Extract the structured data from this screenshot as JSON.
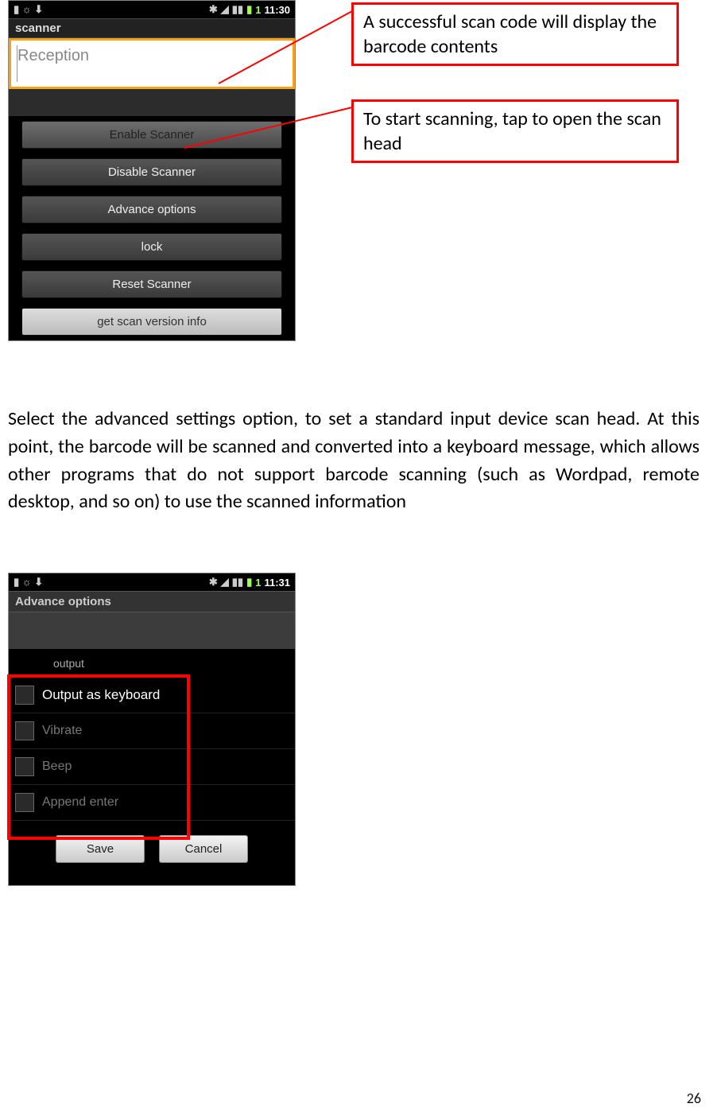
{
  "callouts": {
    "scan_result": "A successful scan code will display the barcode contents",
    "start_scan": "To start scanning, tap to open the scan head"
  },
  "phone1": {
    "status": {
      "left_icons": "▮ ☼ ⬇",
      "bt": "✱",
      "wifi": "◢",
      "sig": "▮▮",
      "bat": "▮",
      "one": "1",
      "time": "11:30"
    },
    "title": "scanner",
    "input_placeholder": "Reception",
    "buttons": {
      "enable": "Enable Scanner",
      "disable": "Disable Scanner",
      "advance": "Advance options",
      "lock": "lock",
      "reset": "Reset Scanner",
      "version": "get scan version info"
    }
  },
  "paragraph": "Select the advanced settings option, to set a standard input device scan head. At this point, the barcode will be scanned and converted into a keyboard message, which allows other programs that do not support barcode scanning (such as Wordpad, remote desktop, and so on) to use the scanned information",
  "phone2": {
    "status": {
      "left_icons": "▮ ☼ ⬇",
      "bt": "✱",
      "wifi": "◢",
      "sig": "▮▮",
      "bat": "▮",
      "one": "1",
      "time": "11:31"
    },
    "title": "Advance options",
    "sub": "output",
    "options": {
      "keyboard": "Output as keyboard",
      "vibrate": "Vibrate",
      "beep": "Beep",
      "append": "Append enter"
    },
    "save": "Save",
    "cancel": "Cancel"
  },
  "page_number": "26"
}
